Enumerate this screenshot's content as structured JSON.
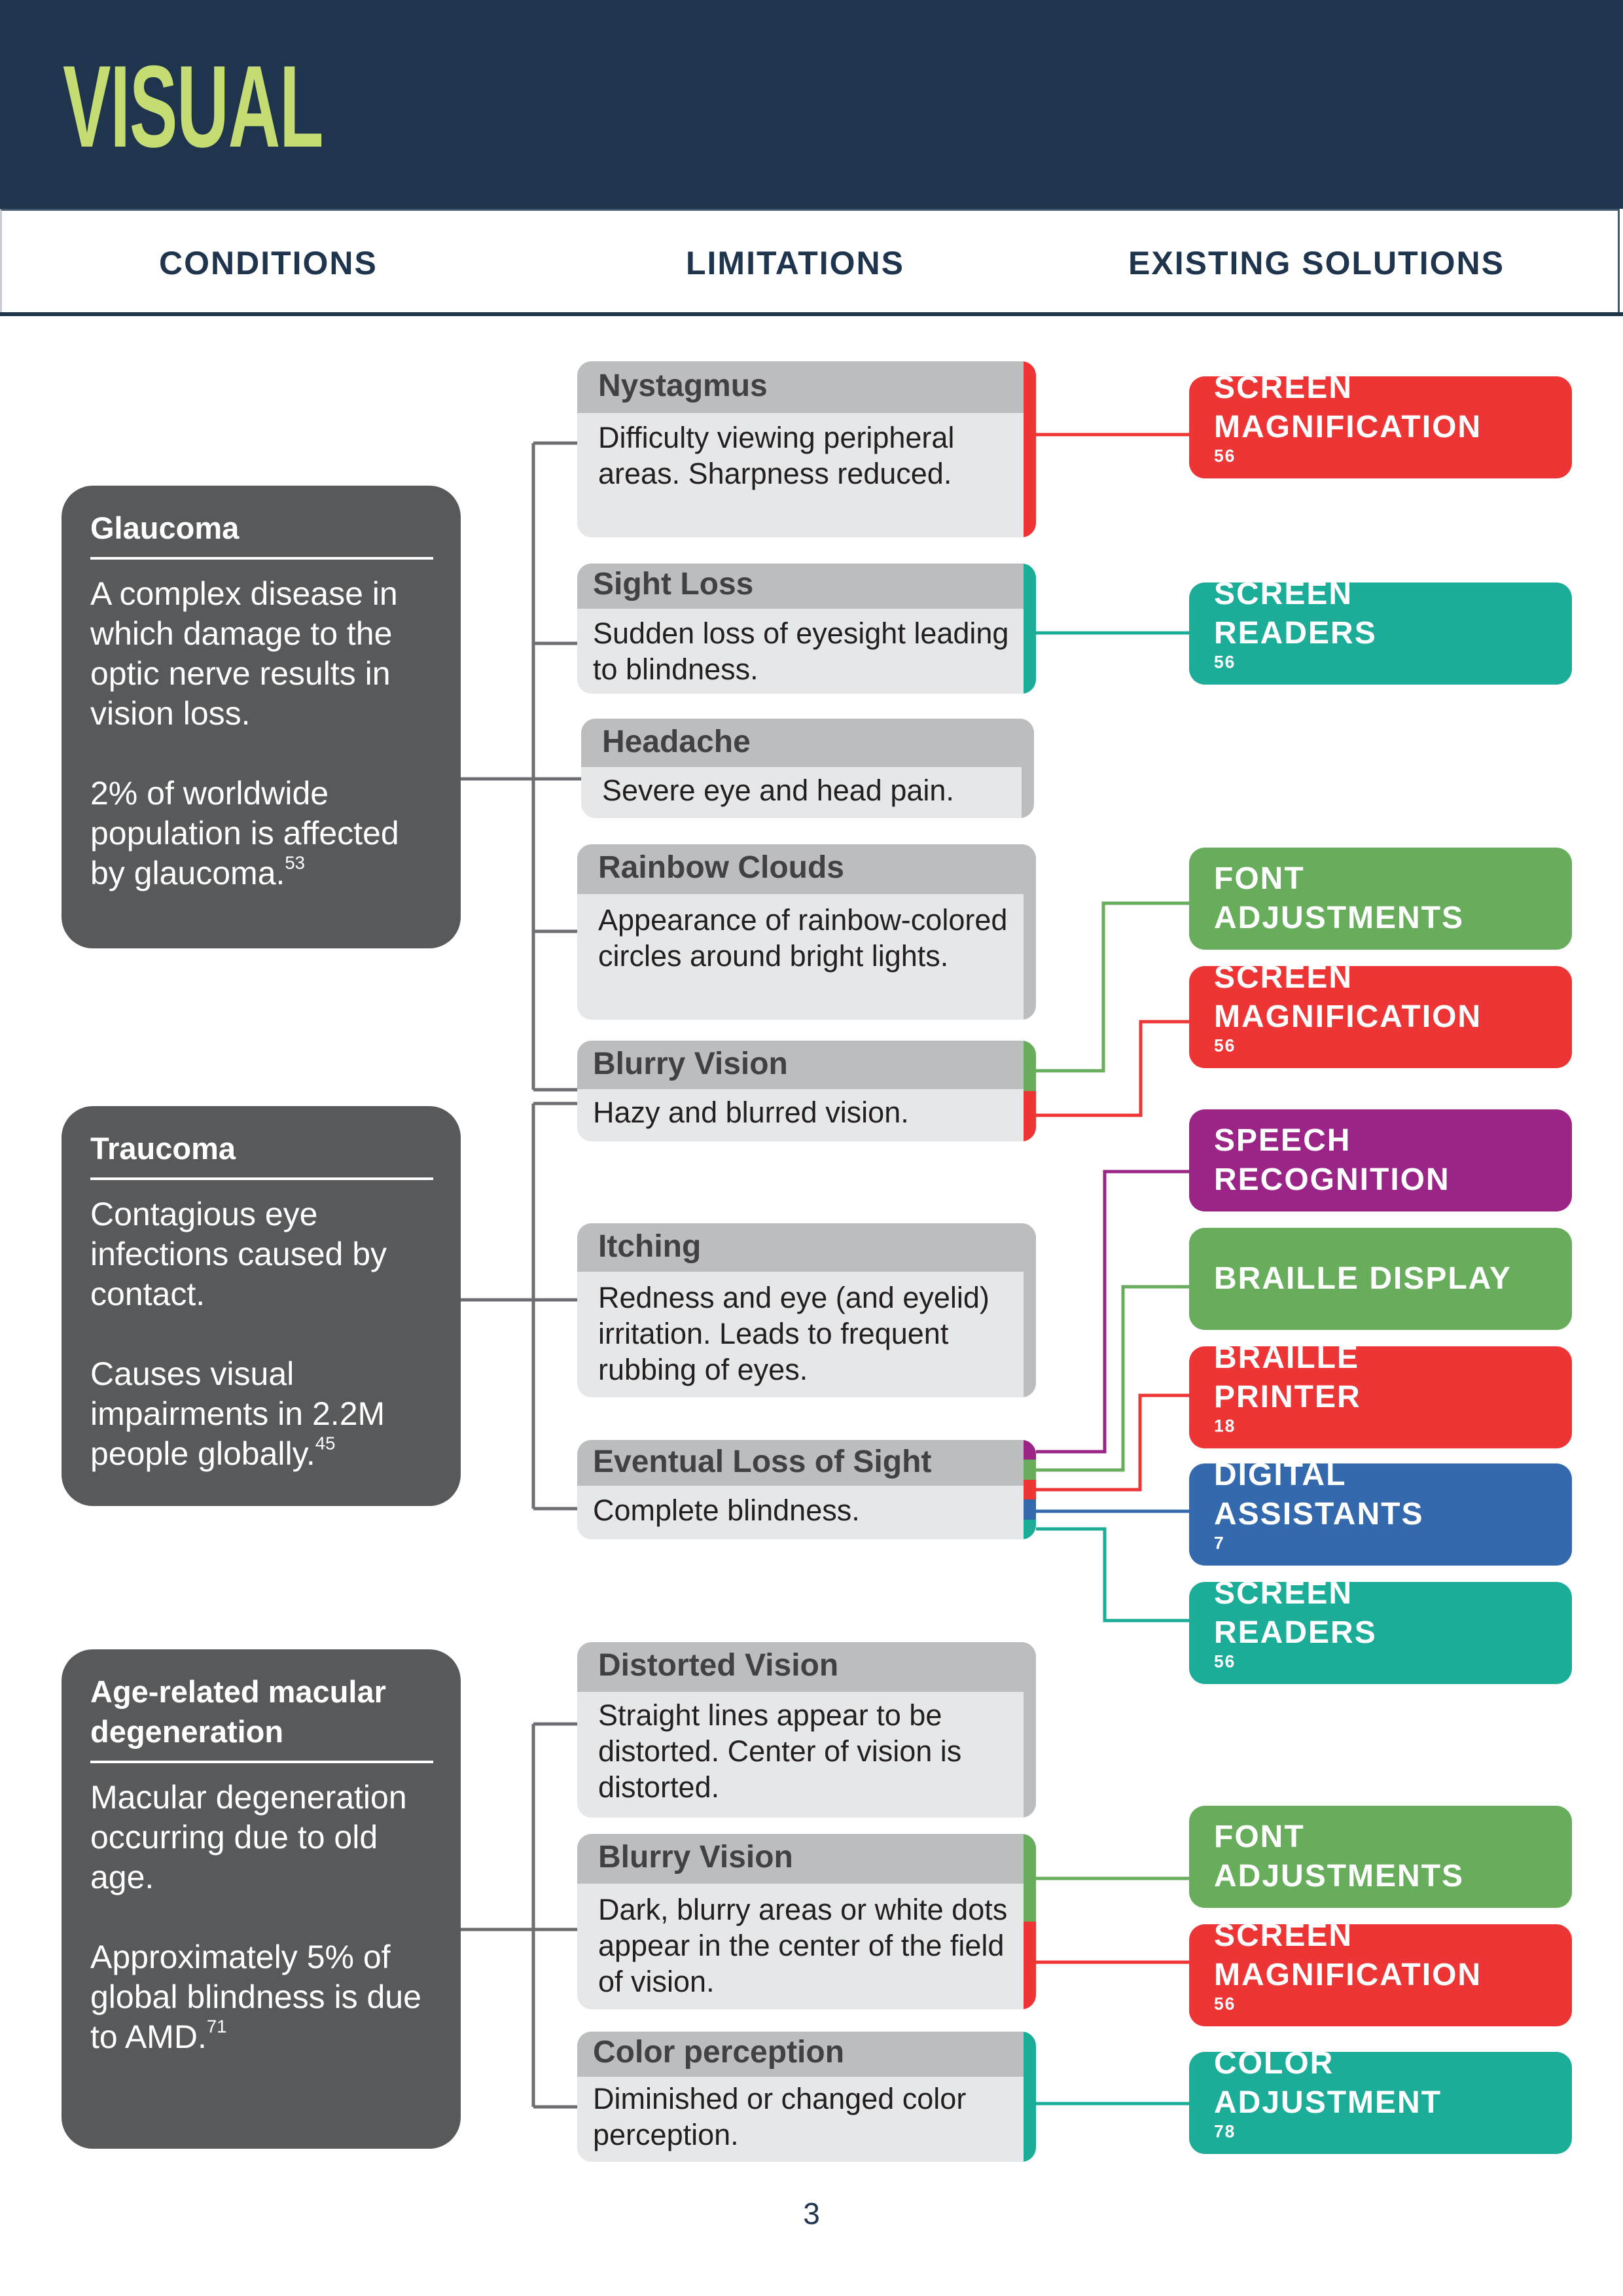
{
  "header": {
    "title": "VISUAL",
    "columns": [
      "CONDITIONS",
      "LIMITATIONS",
      "EXISTING SOLUTIONS"
    ]
  },
  "colors": {
    "header_bg": "#1F344D",
    "title": "#C5DC73",
    "condition_bg": "#58595B",
    "limitation_head": "#BCBDBF",
    "limitation_body": "#E6E7E8",
    "connector_gray": "#6D6E71",
    "red": "#EE3536",
    "teal": "#1CAD99",
    "green": "#67AD5B",
    "purple": "#9B2487",
    "blue": "#3469AD"
  },
  "conditions": [
    {
      "title": "Glaucoma",
      "paragraphs": [
        {
          "text": "A complex disease in which damage to the optic nerve results in vision loss.",
          "ref": ""
        },
        {
          "text": "2% of worldwide population is affected by glaucoma.",
          "ref": "53"
        }
      ]
    },
    {
      "title": "Traucoma",
      "paragraphs": [
        {
          "text": "Contagious eye infections caused by contact.",
          "ref": ""
        },
        {
          "text": "Causes visual impairments in 2.2M people globally.",
          "ref": "45"
        }
      ]
    },
    {
      "title": "Age-related macular degeneration",
      "paragraphs": [
        {
          "text": "Macular degeneration occurring due to old age.",
          "ref": ""
        },
        {
          "text": "Approximately 5% of global blindness is due to AMD.",
          "ref": "71"
        }
      ]
    }
  ],
  "limitations": [
    {
      "title": "Nystagmus",
      "description": "Difficulty viewing peripheral areas. Sharpness reduced.",
      "condition": "Glaucoma",
      "solutions": [
        "Screen Magnification"
      ]
    },
    {
      "title": "Sight Loss",
      "description": "Sudden loss of eyesight leading to blindness.",
      "condition": "Glaucoma",
      "solutions": [
        "Screen Readers"
      ]
    },
    {
      "title": "Headache",
      "description": "Severe eye and head pain.",
      "condition": "Glaucoma",
      "solutions": []
    },
    {
      "title": "Rainbow Clouds",
      "description": "Appearance of rainbow-colored circles around bright lights.",
      "condition": "Glaucoma",
      "solutions": []
    },
    {
      "title": "Blurry Vision",
      "description": "Hazy and blurred vision.",
      "condition": "Glaucoma / Traucoma",
      "solutions": [
        "Font Adjustments",
        "Screen Magnification"
      ]
    },
    {
      "title": "Itching",
      "description": "Redness and eye (and eyelid) irritation. Leads to frequent rubbing of eyes.",
      "condition": "Traucoma",
      "solutions": []
    },
    {
      "title": "Eventual Loss of Sight",
      "description": "Complete blindness.",
      "condition": "Traucoma",
      "solutions": [
        "Speech Recognition",
        "Braille Display",
        "Braille Printer",
        "Digital Assistants",
        "Screen Readers"
      ]
    },
    {
      "title": "Distorted Vision",
      "description": "Straight lines appear to be distorted. Center of vision is distorted.",
      "condition": "Age-related macular degeneration",
      "solutions": []
    },
    {
      "title": "Blurry Vision",
      "description": "Dark, blurry areas or white dots appear in the center of the field of vision.",
      "condition": "Age-related macular degeneration",
      "solutions": [
        "Font Adjustments",
        "Screen Magnification"
      ]
    },
    {
      "title": "Color perception",
      "description": "Diminished or changed color perception.",
      "condition": "Age-related macular degeneration",
      "solutions": [
        "Color Adjustment"
      ]
    }
  ],
  "solutions": [
    {
      "line1": "SCREEN",
      "line2": "MAGNIFICATION",
      "ref": "56",
      "color": "#EE3536"
    },
    {
      "line1": "SCREEN",
      "line2": "READERS",
      "ref": "56",
      "color": "#1CAD99"
    },
    {
      "line1": "FONT",
      "line2": "ADJUSTMENTS",
      "ref": "",
      "color": "#67AD5B"
    },
    {
      "line1": "SCREEN",
      "line2": "MAGNIFICATION",
      "ref": "56",
      "color": "#EE3536"
    },
    {
      "line1": "SPEECH",
      "line2": "RECOGNITION",
      "ref": "",
      "color": "#9B2487"
    },
    {
      "line1": "BRAILLE DISPLAY",
      "line2": "",
      "ref": "",
      "color": "#67AD5B"
    },
    {
      "line1": "BRAILLE",
      "line2": "PRINTER",
      "ref": "18",
      "color": "#EE3536"
    },
    {
      "line1": "DIGITAL",
      "line2": "ASSISTANTS",
      "ref": "7",
      "color": "#3469AD"
    },
    {
      "line1": "SCREEN",
      "line2": "READERS",
      "ref": "56",
      "color": "#1CAD99"
    },
    {
      "line1": "FONT",
      "line2": "ADJUSTMENTS",
      "ref": "",
      "color": "#67AD5B"
    },
    {
      "line1": "SCREEN",
      "line2": "MAGNIFICATION",
      "ref": "56",
      "color": "#EE3536"
    },
    {
      "line1": "COLOR",
      "line2": "ADJUSTMENT",
      "ref": "78",
      "color": "#1CAD99"
    }
  ],
  "page_number": "3"
}
